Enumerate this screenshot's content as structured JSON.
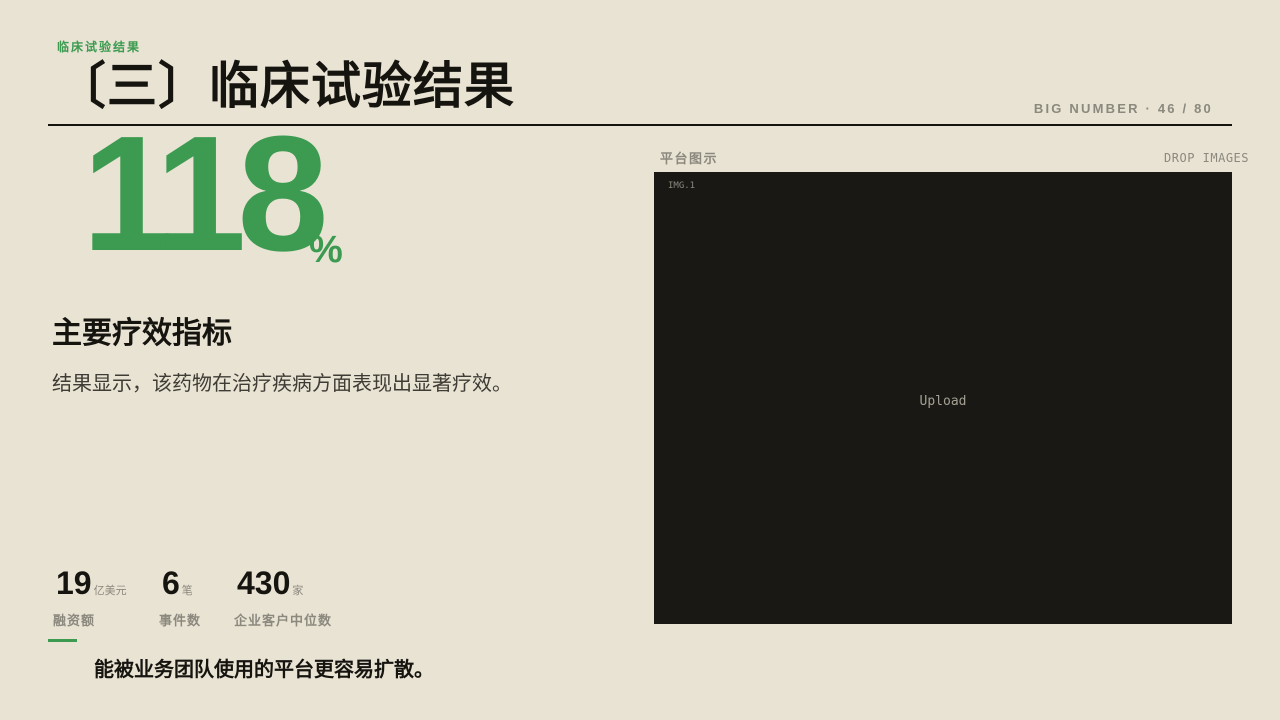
{
  "header": {
    "eyebrow": "临床试验结果",
    "title": "〔三〕临床试验结果",
    "page_tag": "BIG NUMBER · 46 / 80"
  },
  "hero": {
    "value": "118",
    "unit": "%",
    "metric_title": "主要疗效指标",
    "description": "结果显示，该药物在治疗疾病方面表现出显著疗效。"
  },
  "stats": [
    {
      "value": "19",
      "unit": "亿美元",
      "label": "融资额"
    },
    {
      "value": "6",
      "unit": "笔",
      "label": "事件数"
    },
    {
      "value": "430",
      "unit": "家",
      "label": "企业客户中位数"
    }
  ],
  "footnote": "能被业务团队使用的平台更容易扩散。",
  "panel": {
    "label": "平台图示",
    "hint": "DROP IMAGES",
    "slot_tag": "IMG.1",
    "upload_label": "Upload"
  },
  "colors": {
    "background": "#e9e3d4",
    "accent": "#3c9b50",
    "ink": "#16140f",
    "muted": "#8b887d",
    "panel": "#1a1814"
  }
}
